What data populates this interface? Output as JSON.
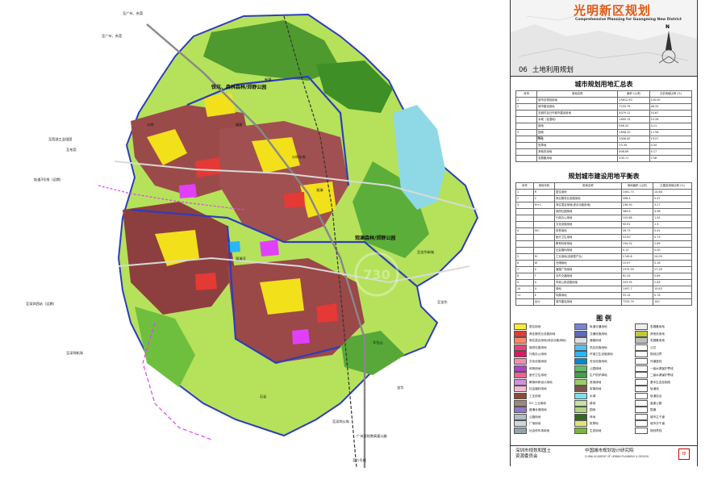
{
  "header": {
    "title": "光明新区规划",
    "subtitle": "Comprehensive Planning for Guangming New District",
    "sheet_number": "06",
    "sheet_title": "土地利用规划",
    "north_label": "N"
  },
  "summary_table": {
    "title": "城市规划用地汇总表",
    "headers": [
      "序号",
      "用地名称",
      "面积 (公顷)",
      "占总用地比例 (%)"
    ],
    "rows": [
      [
        "1",
        "城市总规划用地",
        "15612.90",
        "100.00"
      ],
      [
        "2",
        "城市建设用地",
        "7233.79",
        "46.33"
      ],
      [
        "",
        "农城村及已作城市建设用地",
        "8379.12",
        "53.67"
      ],
      [
        "",
        "水域（含湿地）",
        "1605.13",
        "10.28"
      ],
      [
        "",
        "耕地",
        "658.25",
        "4.21"
      ],
      [
        "3",
        "园地",
        "1808.10",
        "11.58"
      ],
      [
        "",
        "林地",
        "3056.40",
        "19.57"
      ],
      [
        "",
        "牧草地",
        "53.39",
        "0.34"
      ],
      [
        "",
        "其他农用地",
        "808.69",
        "5.17"
      ],
      [
        "",
        "发展备用地",
        "435.71",
        "2.56"
      ]
    ],
    "sub_label": "其中"
  },
  "balance_table": {
    "title": "规划城市建设用地平衡表",
    "headers": [
      "序号",
      "用地代码",
      "用地名称",
      "用地面积 (公顷)",
      "占建设用地比例 (%)"
    ],
    "rows": [
      [
        "1",
        "R",
        "居住用地",
        "1061.73",
        "14.68"
      ],
      [
        "2",
        "C",
        "商业服务业设施用地",
        "398.4",
        "5.47"
      ],
      [
        "3",
        "M+C",
        "商住混合用地(综合功能用地)",
        "236.90",
        "3.27"
      ],
      [
        "",
        "",
        "政府社团用地",
        "369.8",
        "4.98"
      ],
      [
        "",
        "",
        "行政办公用地",
        "105.88",
        "1.45"
      ],
      [
        "",
        "",
        "文化设施用地",
        "90.91",
        "1.3"
      ],
      [
        "4",
        "GIC",
        "体育用地",
        "26.75",
        "0.41"
      ],
      [
        "",
        "",
        "医疗卫生用地",
        "52.00",
        "0.73"
      ],
      [
        "",
        "",
        "教育科研用地",
        "194.02",
        "2.69"
      ],
      [
        "",
        "",
        "社会福利用地",
        "0.13",
        "0.00"
      ],
      [
        "5",
        "M",
        "工业用地(含新型产业)",
        "1749.6",
        "24.09"
      ],
      [
        "6",
        "W",
        "仓储用地",
        "10.97",
        "0.16"
      ],
      [
        "7",
        "S",
        "道路广场用地",
        "1975.59",
        "27.28"
      ],
      [
        "8",
        "T",
        "对外交通用地",
        "62.35",
        "0.89"
      ],
      [
        "9",
        "U",
        "市政公用设施用地",
        "203.95",
        "2.83"
      ],
      [
        "10",
        "G",
        "绿地",
        "1097.7",
        "15.83"
      ],
      [
        "11",
        "E",
        "特殊用地",
        "55.14",
        "0.76"
      ],
      [
        "",
        "合计",
        "城市建设用地",
        "7233.79",
        "100"
      ]
    ]
  },
  "legend": {
    "title": "图 例",
    "items": [
      {
        "label": "居住用地",
        "color": "#ffeb3b"
      },
      {
        "label": "商业服务业设施用地",
        "color": "#e53935"
      },
      {
        "label": "商住混合用地(综合功能用地)",
        "color": "#ff8a65"
      },
      {
        "label": "政府社团用地",
        "color": "#ec407a"
      },
      {
        "label": "行政办公用地",
        "color": "#d81b60"
      },
      {
        "label": "文化设施用地",
        "color": "#f48fb1"
      },
      {
        "label": "体育用地",
        "color": "#ab47bc"
      },
      {
        "label": "医疗卫生用地",
        "color": "#f06292"
      },
      {
        "label": "教育科研设计用地",
        "color": "#ce93d8"
      },
      {
        "label": "社会福利用地",
        "color": "#f8bbd0"
      },
      {
        "label": "工业用地",
        "color": "#8d4a3a"
      },
      {
        "label": "M1 工业用地",
        "color": "#a1887f"
      },
      {
        "label": "普通仓储用地",
        "color": "#9575cd"
      },
      {
        "label": "公路用地",
        "color": "#b0bec5"
      },
      {
        "label": "广场用地",
        "color": "#cfd8dc"
      },
      {
        "label": "社会停车场用地",
        "color": "#90a4ae"
      },
      {
        "label": "轨道交通用地",
        "color": "#7986cb"
      },
      {
        "label": "交通设施用地",
        "color": "#5c6bc0"
      },
      {
        "label": "道路用地",
        "color": "#e0e0e0"
      },
      {
        "label": "供应设施用地",
        "color": "#4fc3f7"
      },
      {
        "label": "环境卫生设施用地",
        "color": "#29b6f6"
      },
      {
        "label": "安全设施用地",
        "color": "#0288d1"
      },
      {
        "label": "公园绿地",
        "color": "#66bb6a"
      },
      {
        "label": "生产防护绿地",
        "color": "#43a047"
      },
      {
        "label": "其他绿地",
        "color": "#9ccc65"
      },
      {
        "label": "军事用地",
        "color": "#795548"
      },
      {
        "label": "水域",
        "color": "#80deea"
      },
      {
        "label": "耕地",
        "color": "#c5e1a5"
      },
      {
        "label": "园地",
        "color": "#aed581"
      },
      {
        "label": "林地",
        "color": "#33691e"
      },
      {
        "label": "牧草地",
        "color": "#dce775"
      },
      {
        "label": "生态用地",
        "color": "#7cb342"
      },
      {
        "label": "发展备用地",
        "color": "#eeeeee"
      },
      {
        "label": "其他农用地",
        "color": "#c0ca33"
      },
      {
        "label": "发展备用地",
        "color": "#bdbdbd"
      },
      {
        "label": "公共",
        "color": "#ffffff"
      },
      {
        "label": "规划边界",
        "color": "#ffffff"
      },
      {
        "label": "河道蓝线",
        "color": "#ffffff"
      },
      {
        "label": "一级水源保护界线",
        "color": "#ffffff"
      },
      {
        "label": "二级水源保护界线",
        "color": "#ffffff"
      },
      {
        "label": "基本生态控制线",
        "color": "#ffffff"
      },
      {
        "label": "轨道线",
        "color": "#ffffff"
      },
      {
        "label": "轨道站点",
        "color": "#ffffff"
      },
      {
        "label": "高速公路",
        "color": "#ffffff"
      },
      {
        "label": "国道",
        "color": "#ffffff"
      },
      {
        "label": "城市主干道",
        "color": "#ffffff"
      },
      {
        "label": "城市次干道",
        "color": "#ffffff"
      },
      {
        "label": "规划界线",
        "color": "#ffffff"
      }
    ]
  },
  "footer": {
    "left_line1": "深圳市规划和国土",
    "left_line2": "资源委员会",
    "right_line1": "中国城市规划设计研究院",
    "right_sub": "CHINA ACADEMY OF URBAN PLANNING & DESIGN",
    "seal_text": "印"
  },
  "map_labels": [
    {
      "text": "至广州、东莞"
    },
    {
      "text": "至广州、东莞"
    },
    {
      "text": "新塘"
    },
    {
      "text": "铁坑、森林森林/郊野公园"
    },
    {
      "text": "公明"
    },
    {
      "text": "塘尾"
    },
    {
      "text": "至西部工业组团"
    },
    {
      "text": "至东莞"
    },
    {
      "text": "轨道3号线（远期）"
    },
    {
      "text": "至深圳西站（远期）"
    },
    {
      "text": "公明水库"
    },
    {
      "text": "观澜"
    },
    {
      "text": "观澜森林/郊野公园"
    },
    {
      "text": "观澜河"
    },
    {
      "text": "羊台山"
    },
    {
      "text": "至龙华新城"
    },
    {
      "text": "至深圳机场"
    },
    {
      "text": "至龙华"
    },
    {
      "text": "石岩"
    },
    {
      "text": "至深圳火车"
    },
    {
      "text": "至二号线"
    },
    {
      "text": "广州深圳港高速公路"
    },
    {
      "text": "龙华"
    }
  ]
}
